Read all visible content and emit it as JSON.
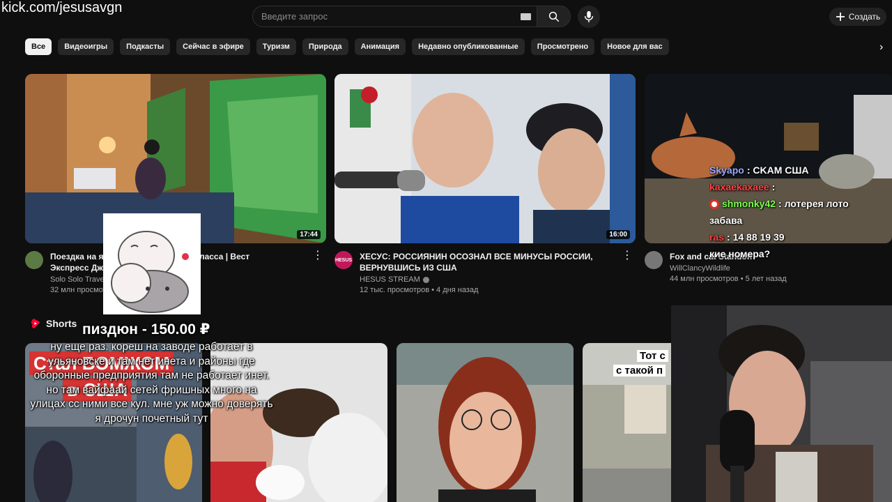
{
  "watermark": "kick.com/jesusavgn",
  "header": {
    "search_placeholder": "Введите запрос",
    "create_label": "Создать"
  },
  "chips": [
    "Все",
    "Видеоигры",
    "Подкасты",
    "Сейчас в эфире",
    "Туризм",
    "Природа",
    "Анимация",
    "Недавно опубликованные",
    "Просмотрено",
    "Новое для вас"
  ],
  "videos": [
    {
      "title": "Поездка на я… первого класса | Вест Экспресс Дж…",
      "title_line1_left": "Поездка на я",
      "title_line1_right": "первого класса | Вест",
      "title_line2": "Экспресс Дж",
      "channel": "Solo Solo Travel",
      "stats": "32 млн просмотр",
      "duration": "17:44",
      "avatar_color": "#5c7a44"
    },
    {
      "title_line1": "ХЕСУС: РОССИЯНИН ОСОЗНАЛ ВСЕ МИНУСЫ РОССИИ,",
      "title_line2": "ВЕРНУВШИСЬ ИЗ США",
      "channel": "HESUS STREAM",
      "stats": "12 тыс. просмотров • 4 дня назад",
      "duration": "16:00",
      "avatar_label": "HESUS",
      "avatar_color": "#c2185b"
    },
    {
      "title_line1": "Fox and cat Standoff",
      "channel": "WillClancyWildlife",
      "stats": "44 млн просмотров • 5 лет назад",
      "avatar_color": "#777777"
    }
  ],
  "shorts": {
    "label": "Shorts",
    "short1_overlay_line1": "Стал БОМЖОМ",
    "short1_overlay_line2": "в США",
    "short4_overlay_line1": "Тот с",
    "short4_overlay_line2": "с такой п"
  },
  "donation": {
    "title": "пиздюн - 150.00 ₽",
    "message": "ну еще раз. кореш на заводе работает в ульяновске и там нет инета и районы где оборонные предприятия там не работает инет. но там вайфаай сетей фришных много на улицах сс ними все кул. мне уж можно доверять я дрочун почетный тут"
  },
  "chat": [
    {
      "user": "Skyapo",
      "text": ": CKAM США",
      "color": "#9aa7ff"
    },
    {
      "user": "kaxaekaxaee",
      "text": ":",
      "color": "#ff4040"
    },
    {
      "user": "shmonky42",
      "text": ": лотерея лото",
      "color": "#7cff4f"
    },
    {
      "user": "",
      "text": "забава",
      "color": "#ffffff"
    },
    {
      "user": "ras",
      "text": ": 14 88 19 39",
      "color": "#ff4040"
    },
    {
      "user": "",
      "text": "кие номера?",
      "color": "#ffffff"
    }
  ],
  "colors": {
    "background": "#0f0f0f",
    "chip": "#272727",
    "accent_red": "#ff0033"
  }
}
